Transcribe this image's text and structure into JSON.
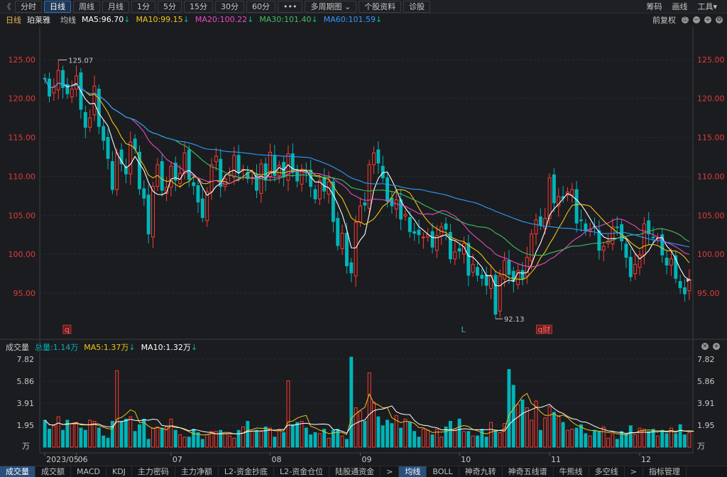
{
  "toolbar": {
    "back": "《",
    "periods": [
      "分时",
      "日线",
      "周线",
      "月线",
      "1分",
      "5分",
      "15分",
      "30分",
      "60分",
      "•••",
      "多周期图 ⌄",
      "个股资料",
      "诊股"
    ],
    "active": "日线",
    "right": {
      "chips": "筹码",
      "draw": "画线",
      "tools": "工具▾"
    }
  },
  "info": {
    "period": "日线",
    "name": "珀莱雅",
    "ma_label": "均线",
    "ma5": "MA5:96.70",
    "ma10": "MA10:99.15",
    "ma20": "MA20:100.22",
    "ma30": "MA30:101.40",
    "ma60": "MA60:101.59",
    "adjust": "前复权"
  },
  "colors": {
    "up": "#ff3b30",
    "down": "#00b5b8",
    "ma5": "#ffffff",
    "ma10": "#f0c419",
    "ma20": "#e64bc0",
    "ma30": "#3fbf5f",
    "ma60": "#2f9bff",
    "axis_text": "#e03a3a",
    "vol_axis_text": "#c8c8c8"
  },
  "vol_info": {
    "label": "成交量",
    "total": "总量:1.14万",
    "ma5": "MA5:1.37万",
    "ma10": "MA10:1.32万"
  },
  "bottom_tabs": [
    "成交量",
    "成交额",
    "MACD",
    "KDJ",
    "主力密码",
    "主力净额",
    "L2-资金抄底",
    "L2-资金仓位",
    "陆股通资金",
    ">",
    "均线",
    "BOLL",
    "神奇九转",
    "神奇五线谱",
    "牛熊线",
    "多空线",
    ">",
    "指标管理"
  ],
  "chart_data": {
    "type": "candlestick",
    "price_axis_labels": [
      "125.00",
      "120.00",
      "115.00",
      "110.00",
      "105.00",
      "100.00",
      "95.00"
    ],
    "price_ticks": [
      125,
      120,
      115,
      110,
      105,
      100,
      95
    ],
    "ylim": [
      89.8,
      129.0
    ],
    "max_label": "125.07",
    "min_label": "92.13",
    "x_labels": [
      "2023/05",
      "06",
      "07",
      "08",
      "09",
      "10",
      "11",
      "12"
    ],
    "x_label_index": [
      0,
      7,
      28,
      50,
      70,
      92,
      112,
      132
    ],
    "markers": [
      {
        "text": "q",
        "index": 5
      },
      {
        "text": "L",
        "index": 93
      },
      {
        "text": "q财",
        "index": 110
      }
    ],
    "close": [
      122.5,
      120.3,
      121.5,
      123.6,
      121.4,
      120.6,
      121.2,
      122.9,
      118.6,
      116.3,
      117.5,
      121.6,
      116.4,
      114.6,
      112.3,
      108.3,
      113.0,
      111.6,
      110.3,
      114.4,
      113.5,
      108.4,
      107.2,
      102.6,
      108.7,
      111.5,
      108.2,
      108.6,
      111.3,
      109.5,
      110.4,
      113.0,
      109.6,
      108.8,
      106.7,
      104.7,
      108.0,
      111.5,
      112.6,
      108.7,
      109.7,
      110.3,
      112.7,
      110.5,
      110.9,
      109.7,
      109.8,
      108.2,
      111.6,
      109.5,
      113.1,
      110.1,
      111.4,
      109.9,
      112.9,
      110.5,
      109.4,
      110.7,
      110.4,
      108.7,
      107.1,
      109.5,
      108.1,
      109.3,
      104.2,
      101.1,
      102.7,
      98.5,
      97.6,
      104.1,
      106.2,
      106.3,
      111.5,
      113.0,
      111.7,
      109.8,
      106.8,
      106.2,
      107.0,
      104.5,
      105.1,
      102.9,
      102.7,
      102.5,
      102.2,
      102.5,
      100.9,
      102.4,
      103.5,
      103.2,
      99.4,
      100.3,
      100.4,
      101.4,
      97.3,
      98.7,
      97.3,
      96.9,
      96.0,
      97.3,
      92.3,
      97.2,
      99.2,
      97.4,
      96.5,
      97.9,
      96.8,
      99.6,
      102.6,
      104.4,
      103.7,
      104.6,
      109.8,
      106.6,
      107.4,
      107.2,
      108.0,
      108.3,
      104.0,
      104.3,
      103.0,
      103.2,
      103.4,
      100.5,
      101.0,
      101.7,
      103.5,
      103.4,
      101.7,
      99.6,
      97.1,
      98.7,
      99.9,
      103.9,
      102.6,
      102.1,
      102.1,
      99.9,
      98.6,
      99.4,
      96.9,
      95.7,
      94.9,
      96.7
    ],
    "volume": [
      2.4,
      1.6,
      1.9,
      2.7,
      1.5,
      2.4,
      2.1,
      2.2,
      1.7,
      1.5,
      2.4,
      2.3,
      1.7,
      1.0,
      0.8,
      2.3,
      6.8,
      2.3,
      2.5,
      2.7,
      1.4,
      2.0,
      2.5,
      0.7,
      1.7,
      1.8,
      1.7,
      1.8,
      2.5,
      1.5,
      1.1,
      0.9,
      0.9,
      1.6,
      1.3,
      0.7,
      1.1,
      1.4,
      1.4,
      1.5,
      1.2,
      1.0,
      0.8,
      1.5,
      1.8,
      2.3,
      1.4,
      1.5,
      1.4,
      1.8,
      1.7,
      0.9,
      1.5,
      1.3,
      5.9,
      2.0,
      2.2,
      2.3,
      1.7,
      1.1,
      1.3,
      1.2,
      1.6,
      0.8,
      1.5,
      1.6,
      1.0,
      0.7,
      8.0,
      3.5,
      3.2,
      2.3,
      6.6,
      4.0,
      2.7,
      1.9,
      2.4,
      2.1,
      2.8,
      1.7,
      2.5,
      2.2,
      1.4,
      0.9,
      1.6,
      1.5,
      1.1,
      1.6,
      0.9,
      1.8,
      2.3,
      1.6,
      2.5,
      1.4,
      1.4,
      1.0,
      1.0,
      1.6,
      0.9,
      2.2,
      1.5,
      1.3,
      2.1,
      6.9,
      5.5,
      3.8,
      4.2,
      3.5,
      2.4,
      4.1,
      1.5,
      2.6,
      3.6,
      3.1,
      2.8,
      2.2,
      1.5,
      1.6,
      1.7,
      2.0,
      1.2,
      1.0,
      1.5,
      1.4,
      1.8,
      0.8,
      1.2,
      0.7,
      1.4,
      1.2,
      1.9,
      1.1,
      1.7,
      1.6,
      1.4,
      1.6,
      1.0,
      1.5,
      1.2,
      1.7,
      1.2,
      2.0,
      1.1,
      1.3,
      1.5
    ],
    "vol_axis_labels": [
      "7.82",
      "5.86",
      "3.91",
      "1.95",
      "万"
    ],
    "vol_ticks": [
      7.82,
      5.86,
      3.91,
      1.95
    ],
    "vol_max": 7.82
  }
}
